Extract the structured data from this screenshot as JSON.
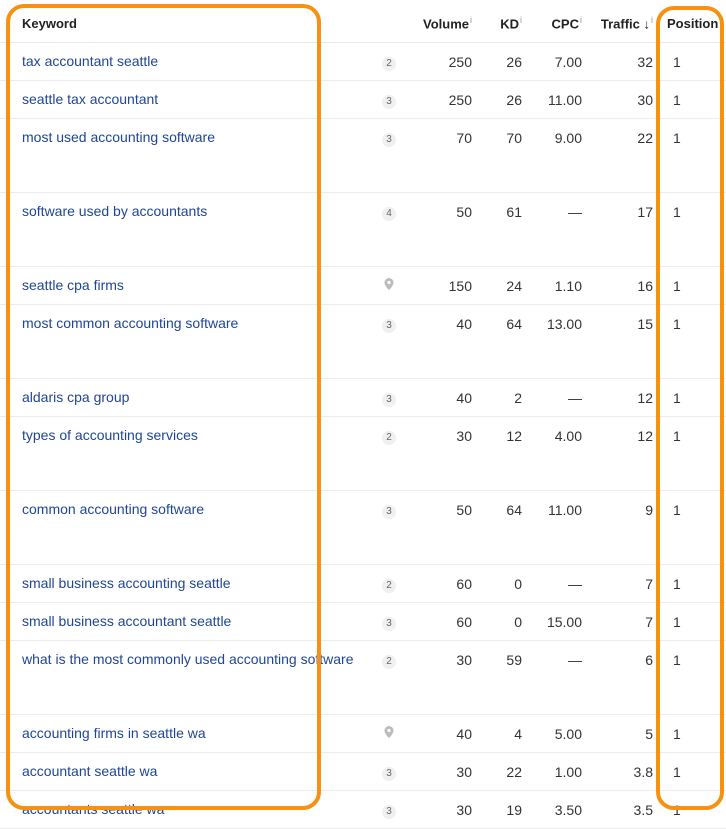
{
  "table": {
    "headers": {
      "keyword": "Keyword",
      "volume": "Volume",
      "kd": "KD",
      "cpc": "CPC",
      "traffic": "Traffic",
      "traffic_sort": "↓",
      "position": "Position",
      "info": "i"
    },
    "rows": [
      {
        "keyword": "tax accountant seattle",
        "serp": "2",
        "volume": "250",
        "kd": "26",
        "cpc": "7.00",
        "traffic": "32",
        "position": "1",
        "tall": false
      },
      {
        "keyword": "seattle tax accountant",
        "serp": "3",
        "volume": "250",
        "kd": "26",
        "cpc": "11.00",
        "traffic": "30",
        "position": "1",
        "tall": false
      },
      {
        "keyword": "most used accounting software",
        "serp": "3",
        "volume": "70",
        "kd": "70",
        "cpc": "9.00",
        "traffic": "22",
        "position": "1",
        "tall": true
      },
      {
        "keyword": "software used by accountants",
        "serp": "4",
        "volume": "50",
        "kd": "61",
        "cpc": "—",
        "traffic": "17",
        "position": "1",
        "tall": true
      },
      {
        "keyword": "seattle cpa firms",
        "serp": "pin",
        "volume": "150",
        "kd": "24",
        "cpc": "1.10",
        "traffic": "16",
        "position": "1",
        "tall": false
      },
      {
        "keyword": "most common accounting software",
        "serp": "3",
        "volume": "40",
        "kd": "64",
        "cpc": "13.00",
        "traffic": "15",
        "position": "1",
        "tall": true
      },
      {
        "keyword": "aldaris cpa group",
        "serp": "3",
        "volume": "40",
        "kd": "2",
        "cpc": "—",
        "traffic": "12",
        "position": "1",
        "tall": false
      },
      {
        "keyword": "types of accounting services",
        "serp": "2",
        "volume": "30",
        "kd": "12",
        "cpc": "4.00",
        "traffic": "12",
        "position": "1",
        "tall": true
      },
      {
        "keyword": "common accounting software",
        "serp": "3",
        "volume": "50",
        "kd": "64",
        "cpc": "11.00",
        "traffic": "9",
        "position": "1",
        "tall": true
      },
      {
        "keyword": "small business accounting seattle",
        "serp": "2",
        "volume": "60",
        "kd": "0",
        "cpc": "—",
        "traffic": "7",
        "position": "1",
        "tall": false
      },
      {
        "keyword": "small business accountant seattle",
        "serp": "3",
        "volume": "60",
        "kd": "0",
        "cpc": "15.00",
        "traffic": "7",
        "position": "1",
        "tall": false
      },
      {
        "keyword": "what is the most commonly used accounting software",
        "serp": "2",
        "volume": "30",
        "kd": "59",
        "cpc": "—",
        "traffic": "6",
        "position": "1",
        "tall": true
      },
      {
        "keyword": "accounting firms in seattle wa",
        "serp": "pin",
        "volume": "40",
        "kd": "4",
        "cpc": "5.00",
        "traffic": "5",
        "position": "1",
        "tall": false
      },
      {
        "keyword": "accountant seattle wa",
        "serp": "3",
        "volume": "30",
        "kd": "22",
        "cpc": "1.00",
        "traffic": "3.8",
        "position": "1",
        "tall": false
      },
      {
        "keyword": "accountants seattle wa",
        "serp": "3",
        "volume": "30",
        "kd": "19",
        "cpc": "3.50",
        "traffic": "3.5",
        "position": "1",
        "tall": false
      }
    ]
  },
  "highlight_color": "#f7910f"
}
